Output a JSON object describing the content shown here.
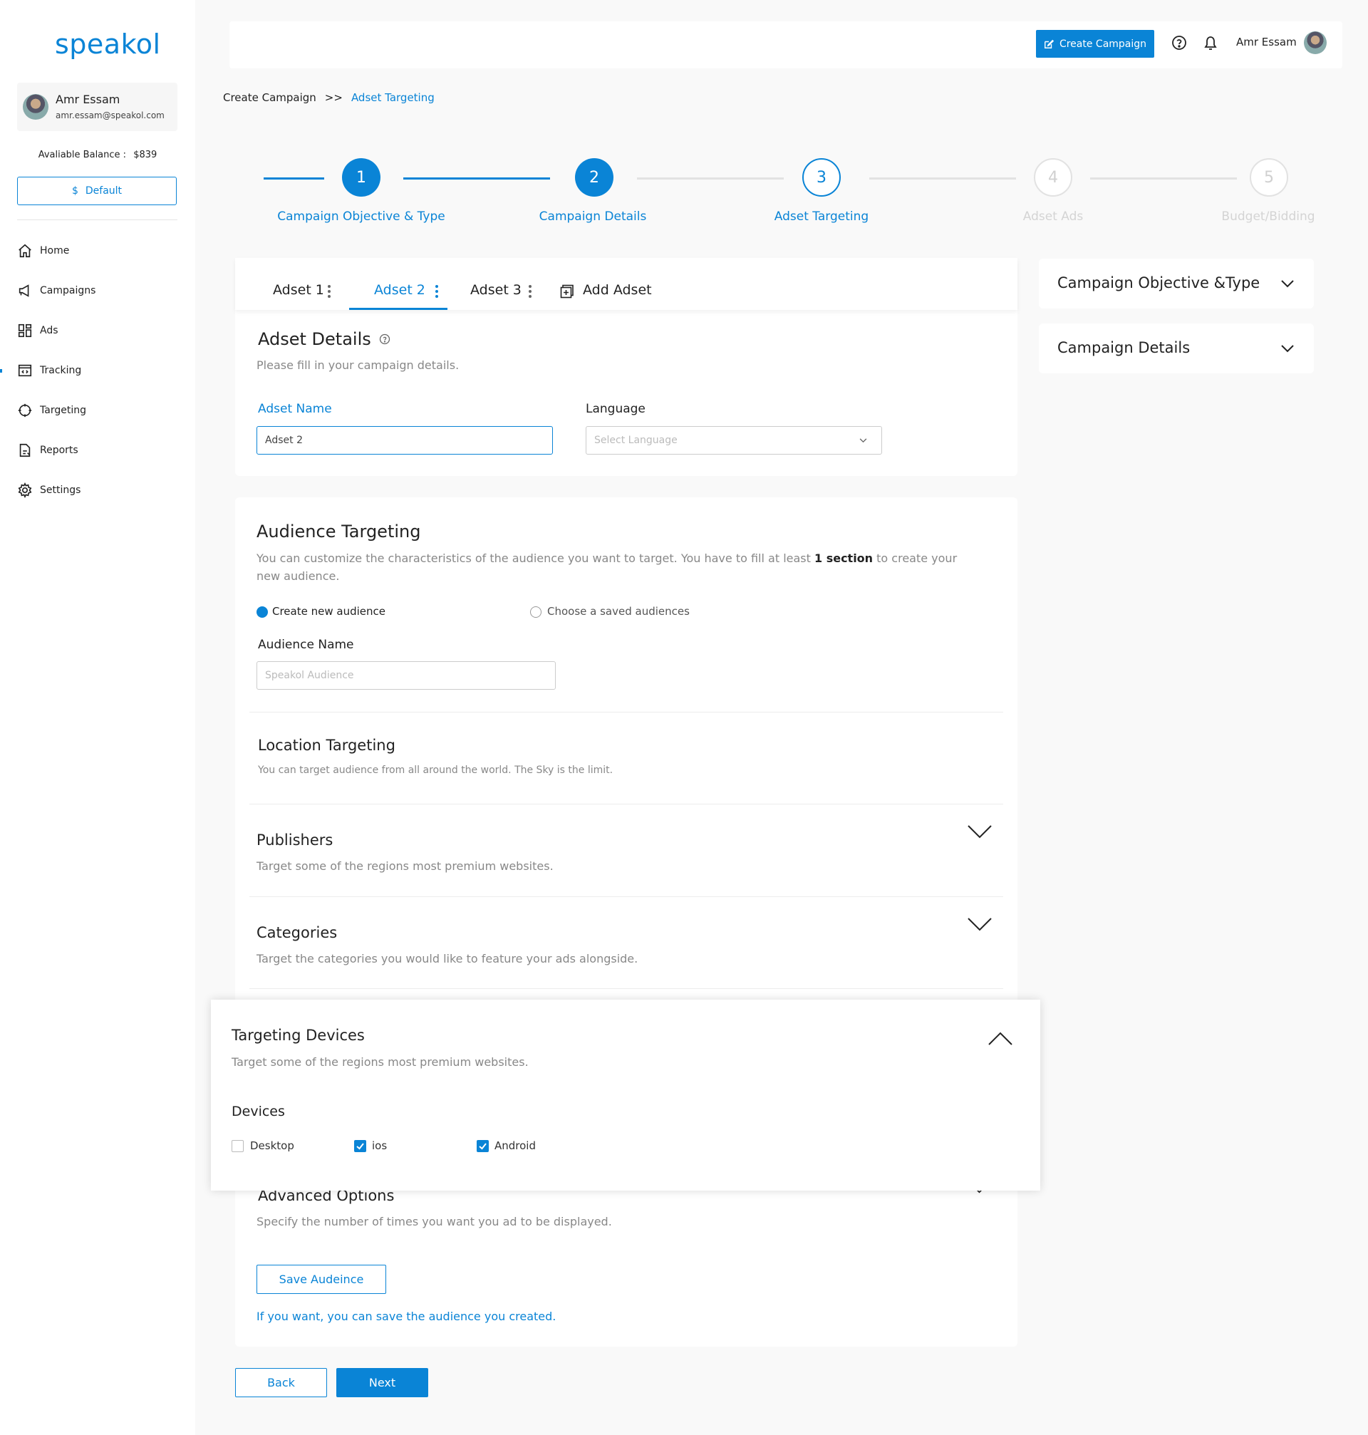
{
  "brand": {
    "logo_text": "speakol",
    "accent": "#0a84d6"
  },
  "sidebar": {
    "profile": {
      "name": "Amr Essam",
      "email": "amr.essam@speakol.com"
    },
    "balance_label": "Avaliable Balance :",
    "balance_value": "$839",
    "default_button": {
      "icon": "dollar-icon",
      "icon_glyph": "$",
      "label": "Default"
    },
    "nav": [
      {
        "label": "Home",
        "icon": "home-icon"
      },
      {
        "label": "Campaigns",
        "icon": "megaphone-icon"
      },
      {
        "label": "Ads",
        "icon": "grid-icon"
      },
      {
        "label": "Tracking",
        "icon": "code-window-icon"
      },
      {
        "label": "Targeting",
        "icon": "crosshair-icon"
      },
      {
        "label": "Reports",
        "icon": "report-icon"
      },
      {
        "label": "Settings",
        "icon": "gear-icon"
      }
    ]
  },
  "topbar": {
    "create_campaign_label": "Create Campaign",
    "user_name": "Amr Essam"
  },
  "breadcrumb": {
    "parent": "Create Campaign",
    "separator": ">>",
    "current": "Adset Targeting"
  },
  "stepper": {
    "steps": [
      {
        "number": "1",
        "label": "Campaign Objective & Type",
        "state": "done"
      },
      {
        "number": "2",
        "label": "Campaign Details",
        "state": "done"
      },
      {
        "number": "3",
        "label": "Adset Targeting",
        "state": "current"
      },
      {
        "number": "4",
        "label": "Adset Ads",
        "state": "upcoming"
      },
      {
        "number": "5",
        "label": "Budget/Bidding",
        "state": "upcoming"
      }
    ]
  },
  "tabs": {
    "items": [
      "Adset 1",
      "Adset 2",
      "Adset 3"
    ],
    "active_index": 1,
    "add_label": "Add Adset"
  },
  "adset_details": {
    "title": "Adset Details",
    "subtitle": "Please fill in your campaign details.",
    "name_label": "Adset Name",
    "name_value": "Adset 2",
    "language_label": "Language",
    "language_placeholder": "Select Language"
  },
  "audience": {
    "title": "Audience Targeting",
    "desc_part1": "You can customize the characteristics of the audience you want to target. You have to fill at least ",
    "desc_bold": "1 section",
    "desc_part2": " to create your",
    "desc_line2": "new audience.",
    "option_new": "Create new audience",
    "option_saved": "Choose a saved audiences",
    "name_label": "Audience Name",
    "name_placeholder": "Speakol Audience"
  },
  "location": {
    "title": "Location Targeting",
    "subtitle": "You can  target audience from all around the world. The Sky is the limit."
  },
  "publishers": {
    "title": "Publishers",
    "subtitle": "Target some of the regions most premium websites."
  },
  "categories": {
    "title": "Categories",
    "subtitle": "Target the categories you would like to feature your ads alongside."
  },
  "devices_panel": {
    "title": "Targeting Devices",
    "subtitle": "Target some of the regions most premium websites.",
    "devices_label": "Devices",
    "devices": [
      {
        "label": "Desktop",
        "checked": false
      },
      {
        "label": "ios",
        "checked": true
      },
      {
        "label": "Android",
        "checked": true
      }
    ]
  },
  "advanced": {
    "title": "Advanced Options",
    "subtitle": "Specify the number of times you want you ad to be displayed.",
    "save_button": "Save Audeince",
    "save_hint": "If you want, you can save the audience you created."
  },
  "right_panels": [
    {
      "title": "Campaign Objective &Type"
    },
    {
      "title": "Campaign Details"
    }
  ],
  "footer": {
    "back_label": "Back",
    "next_label": "Next"
  }
}
